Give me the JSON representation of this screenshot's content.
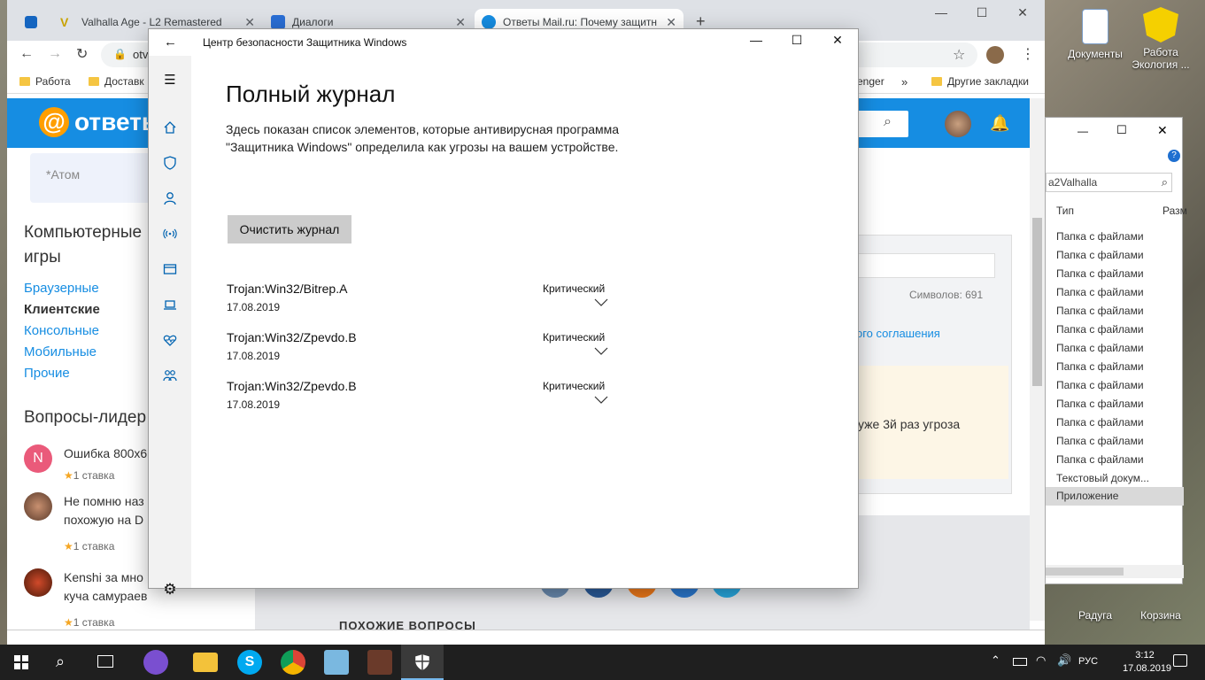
{
  "desktop": {
    "icons": [
      {
        "label": "Документы"
      },
      {
        "label": "Работа Экология ..."
      },
      {
        "label": "Радуга"
      },
      {
        "label": "Корзина"
      }
    ]
  },
  "browser": {
    "tabs": [
      {
        "title": "Valhalla Age - L2 Remastered"
      },
      {
        "title": "Диалоги"
      },
      {
        "title": "Ответы Mail.ru: Почему защитн"
      }
    ],
    "address_fragment": "otv",
    "bookmarks": [
      {
        "label": "Работа"
      },
      {
        "label": "Доставк"
      },
      {
        "label": "enger"
      },
      {
        "label": "Другие закладки"
      }
    ]
  },
  "mail_page": {
    "logo": "ответы",
    "topic_placeholder": "*Атом",
    "categories_title": "Компьютерные игры",
    "categories": [
      {
        "label": "Браузерные",
        "active": false
      },
      {
        "label": "Клиентские",
        "active": true
      },
      {
        "label": "Консольные",
        "active": false
      },
      {
        "label": "Мобильные",
        "active": false
      },
      {
        "label": "Прочие",
        "active": false
      }
    ],
    "leaders_title": "Вопросы-лидер",
    "questions": [
      {
        "text1": "Ошибка 800x6",
        "text2": "",
        "bet": "1 ставка",
        "avatar_letter": "N"
      },
      {
        "text1": "Не помню наз",
        "text2": "похожую на D",
        "bet": "1 ставка",
        "avatar_letter": ""
      },
      {
        "text1": "Kenshi за мно",
        "text2": "куча самураев",
        "bet": "1 ставка",
        "avatar_letter": ""
      }
    ],
    "char_count": "Символов: 691",
    "agreement": "ого соглашения",
    "warning_text": "уже 3й раз угроза",
    "similar": "ПОХОЖИЕ ВОПРОСЫ"
  },
  "explorer": {
    "search": "a2Valhalla",
    "columns": [
      "Тип",
      "Разм"
    ],
    "rows": [
      "Папка с файлами",
      "Папка с файлами",
      "Папка с файлами",
      "Папка с файлами",
      "Папка с файлами",
      "Папка с файлами",
      "Папка с файлами",
      "Папка с файлами",
      "Папка с файлами",
      "Папка с файлами",
      "Папка с файлами",
      "Папка с файлами",
      "Папка с файлами",
      "Текстовый докум...",
      "Приложение"
    ]
  },
  "defender": {
    "window_title": "Центр безопасности Защитника Windows",
    "heading": "Полный журнал",
    "description": "Здесь показан список элементов, которые антивирусная программа \"Защитника Windows\" определила как угрозы на вашем устройстве.",
    "clear_button": "Очистить журнал",
    "threats": [
      {
        "name": "Trojan:Win32/Bitrep.A",
        "date": "17.08.2019",
        "level": "Критический"
      },
      {
        "name": "Trojan:Win32/Zpevdo.B",
        "date": "17.08.2019",
        "level": "Критический"
      },
      {
        "name": "Trojan:Win32/Zpevdo.B",
        "date": "17.08.2019",
        "level": "Критический"
      }
    ]
  },
  "taskbar": {
    "language": "РУС",
    "time": "3:12",
    "date": "17.08.2019"
  }
}
